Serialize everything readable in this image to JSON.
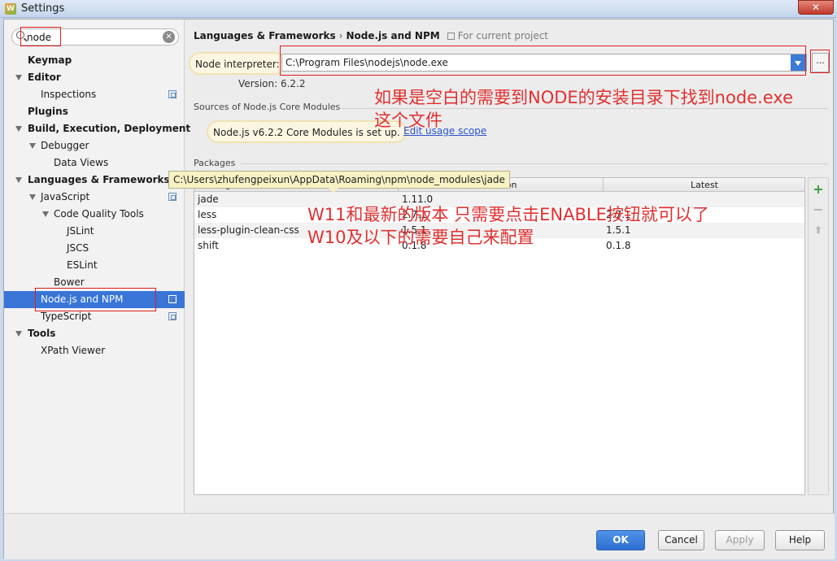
{
  "window": {
    "title": "Settings",
    "close_label": "✕"
  },
  "search": {
    "value": "node",
    "clear_label": "✕"
  },
  "tree": [
    {
      "label": "Keymap",
      "bold": true
    },
    {
      "label": "Editor",
      "bold": true,
      "expanded": true
    },
    {
      "label": "Inspections",
      "project_scoped": true
    },
    {
      "label": "Plugins",
      "bold": true
    },
    {
      "label": "Build, Execution, Deployment",
      "bold": true,
      "expanded": true
    },
    {
      "label": "Debugger",
      "expanded": true
    },
    {
      "label": "Data Views"
    },
    {
      "label": "Languages & Frameworks",
      "bold": true,
      "expanded": true
    },
    {
      "label": "JavaScript",
      "expanded": true,
      "project_scoped": true
    },
    {
      "label": "Code Quality Tools",
      "expanded": true
    },
    {
      "label": "JSLint"
    },
    {
      "label": "JSCS"
    },
    {
      "label": "ESLint"
    },
    {
      "label": "Bower"
    },
    {
      "label": "Node.js and NPM",
      "selected": true,
      "project_scoped": true
    },
    {
      "label": "TypeScript",
      "project_scoped": true
    },
    {
      "label": "Tools",
      "bold": true,
      "expanded": true
    },
    {
      "label": "XPath Viewer"
    }
  ],
  "breadcrumb": {
    "parent": "Languages & Frameworks",
    "separator": "›",
    "current": "Node.js and NPM",
    "scope": "For current project"
  },
  "interpreter": {
    "label": "Node interpreter:",
    "path": "C:\\Program Files\\nodejs\\node.exe",
    "browse_label": "...",
    "version": "Version: 6.2.2"
  },
  "core_modules": {
    "section_label": "Sources of Node.js Core Modules",
    "status": "Node.js v6.2.2 Core Modules is set up.",
    "link": "Edit usage scope"
  },
  "packages": {
    "section_label": "Packages",
    "columns": [
      "Package",
      "Version",
      "Latest"
    ],
    "rows": [
      {
        "name": "jade",
        "version": "1.11.0",
        "latest": ""
      },
      {
        "name": "less",
        "version": "2.7.1",
        "latest": "2.7.1"
      },
      {
        "name": "less-plugin-clean-css",
        "version": "1.5.1",
        "latest": "1.5.1"
      },
      {
        "name": "shift",
        "version": "0.1.8",
        "latest": "0.1.8"
      }
    ],
    "tooltip": "C:\\Users\\zhufengpeixun\\AppData\\Roaming\\npm\\node_modules\\jade",
    "tools": {
      "add": "+",
      "remove": "−",
      "up": "⬆"
    }
  },
  "annotations": {
    "note1_line1": "如果是空白的需要到NODE的安装目录下找到node.exe",
    "note1_line2": "这个文件",
    "note2_line1": "W11和最新的版本 只需要点击ENABLE按钮就可以了",
    "note2_line2": "W10及以下的需要自己来配置",
    "color": "#e03030"
  },
  "buttons": {
    "ok": "OK",
    "cancel": "Cancel",
    "apply": "Apply",
    "help": "Help"
  },
  "colors": {
    "selection": "#3875d7",
    "ok_button": "#2e6fd3",
    "link": "#2a53c9"
  }
}
